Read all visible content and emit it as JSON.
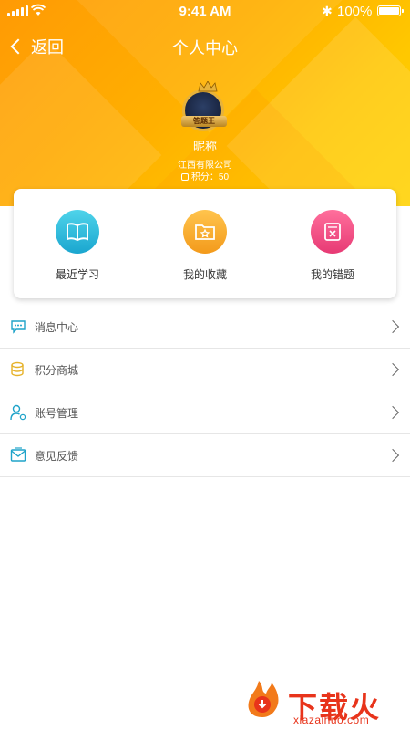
{
  "status_bar": {
    "time": "9:41 AM",
    "battery": "100%"
  },
  "nav": {
    "back_label": "返回",
    "title": "个人中心"
  },
  "profile": {
    "badge_text": "答题王",
    "nickname": "昵称",
    "company": "江西有限公司",
    "points": "积分：50"
  },
  "quick_actions": [
    {
      "label": "最近学习",
      "icon": "book-icon",
      "color": "#1fb1d8"
    },
    {
      "label": "我的收藏",
      "icon": "star-folder-icon",
      "color": "#f6a521"
    },
    {
      "label": "我的错题",
      "icon": "wrong-book-icon",
      "color": "#ec4479"
    }
  ],
  "menu": [
    {
      "label": "消息中心",
      "icon": "message-icon",
      "color": "#1fa3c9"
    },
    {
      "label": "积分商城",
      "icon": "coins-icon",
      "color": "#e6b22a"
    },
    {
      "label": "账号管理",
      "icon": "account-icon",
      "color": "#1fa3c9"
    },
    {
      "label": "意见反馈",
      "icon": "feedback-icon",
      "color": "#1fa3c9"
    }
  ],
  "watermark": {
    "brand": "下载火",
    "domain": "xiazaihuo.com"
  }
}
